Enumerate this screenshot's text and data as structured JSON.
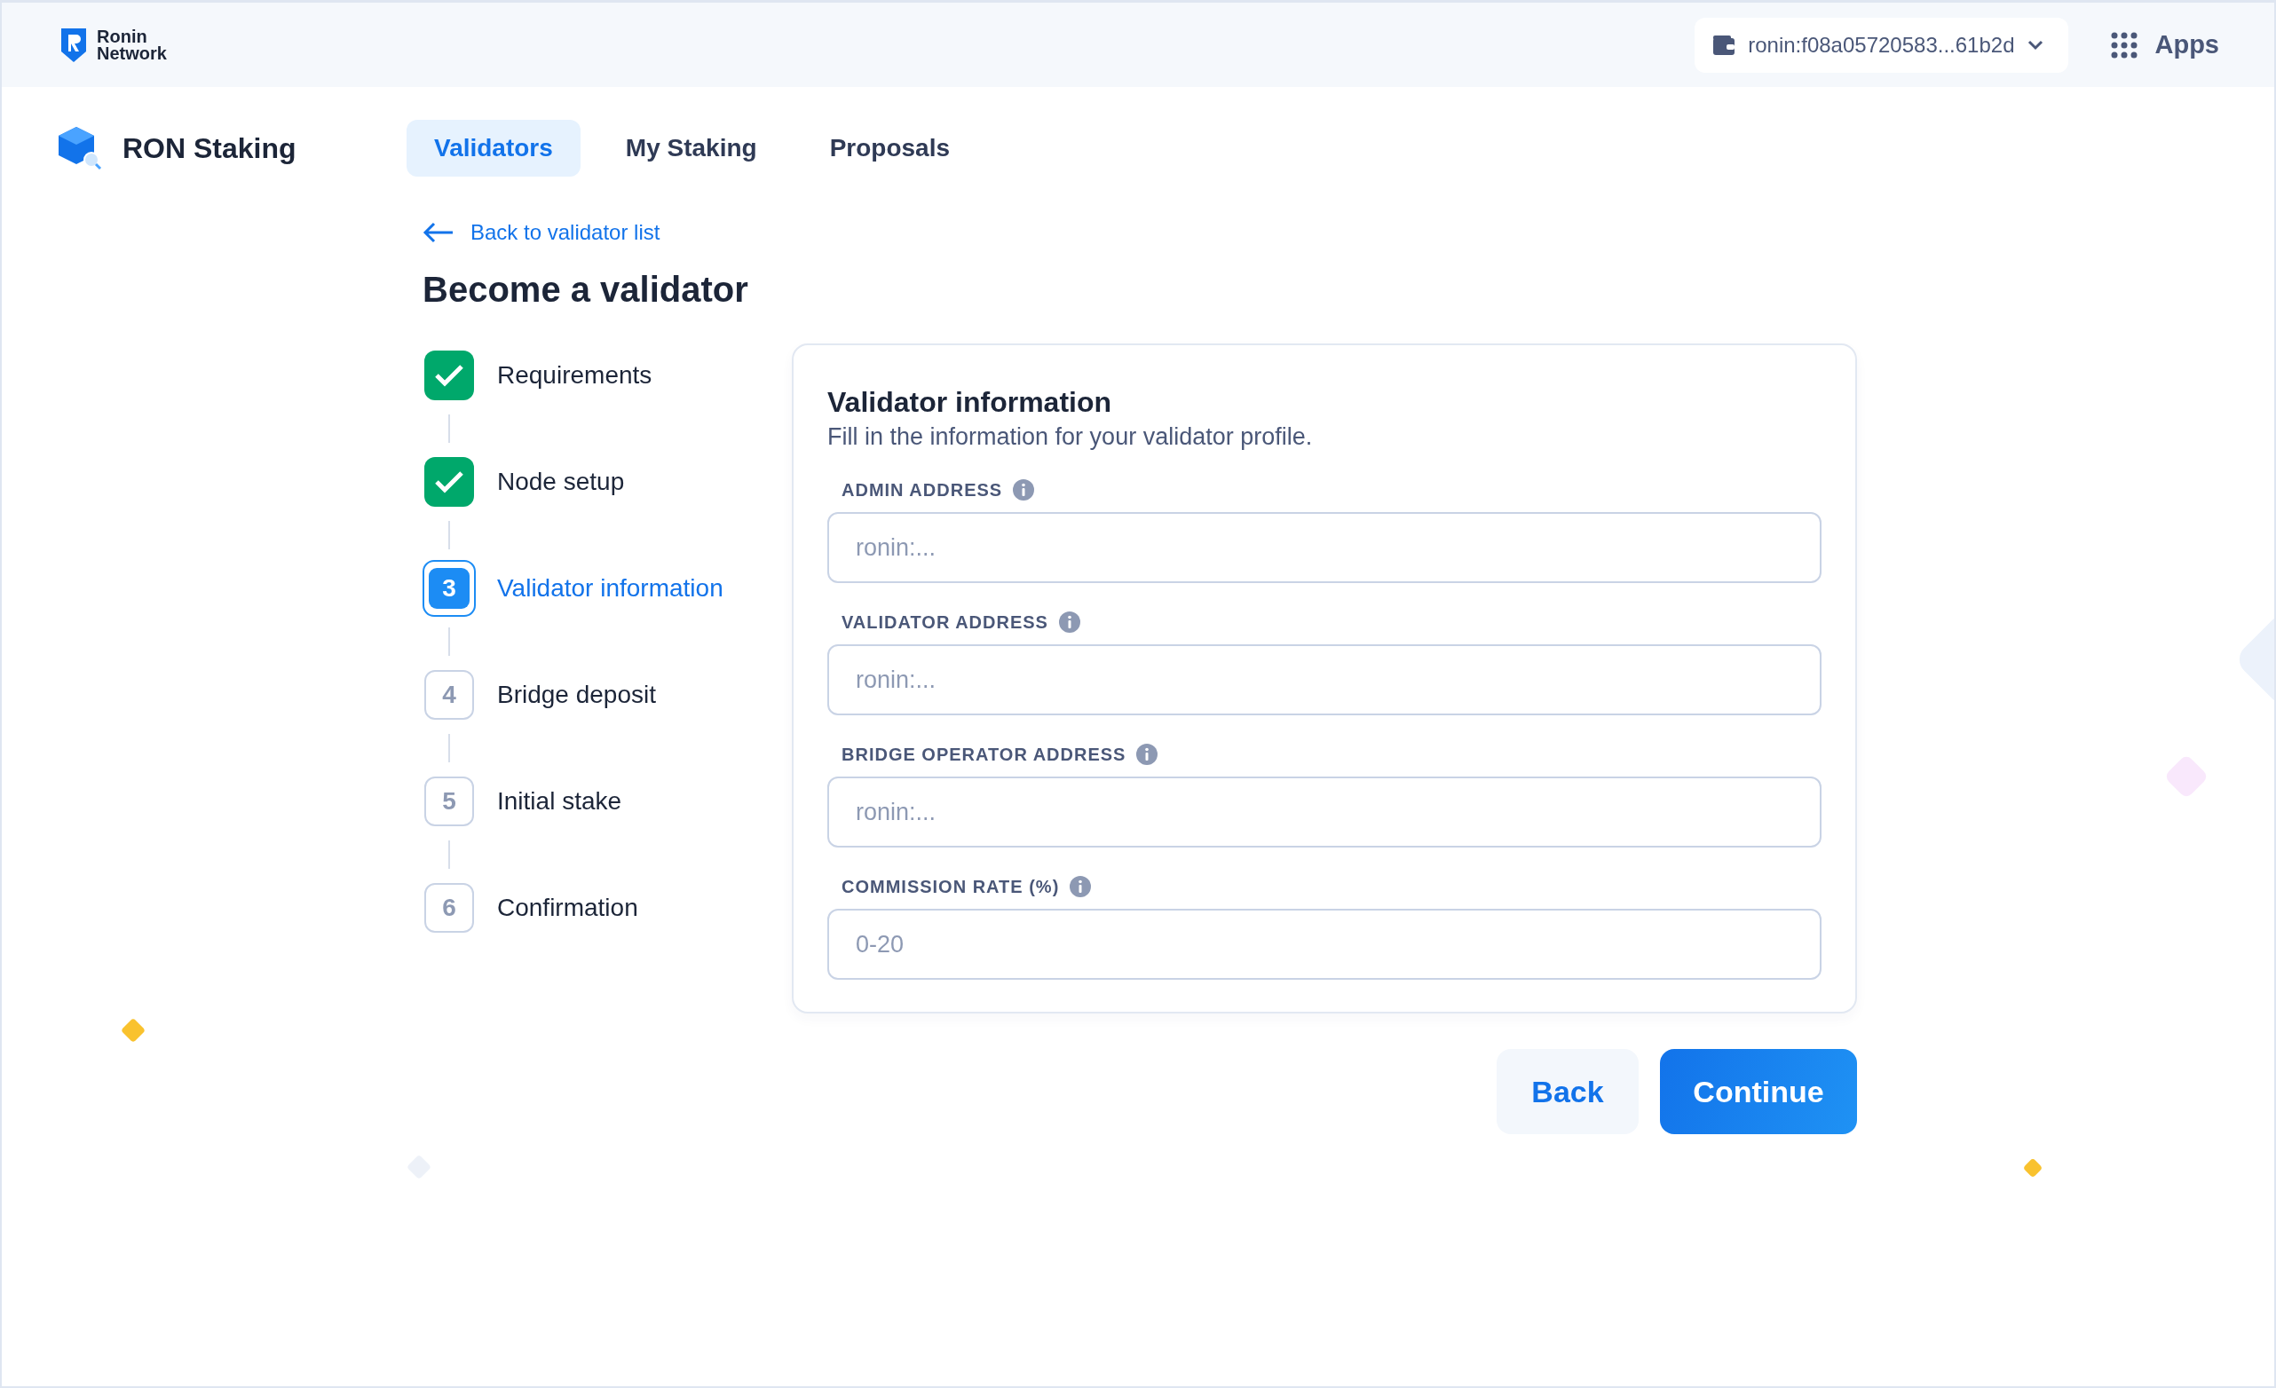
{
  "header": {
    "brand": [
      "Ronin",
      "Network"
    ],
    "wallet": "ronin:f08a05720583...61b2d",
    "apps": "Apps"
  },
  "app": {
    "name": "RON Staking"
  },
  "tabs": [
    {
      "label": "Validators",
      "selected": true
    },
    {
      "label": "My Staking",
      "selected": false
    },
    {
      "label": "Proposals",
      "selected": false
    }
  ],
  "back_link": "Back to validator list",
  "title": "Become a validator",
  "steps": [
    {
      "kind": "done",
      "label": "Requirements"
    },
    {
      "kind": "done",
      "label": "Node setup"
    },
    {
      "kind": "current",
      "number": "3",
      "label": "Validator information"
    },
    {
      "kind": "pending",
      "number": "4",
      "label": "Bridge deposit"
    },
    {
      "kind": "pending",
      "number": "5",
      "label": "Initial stake"
    },
    {
      "kind": "pending",
      "number": "6",
      "label": "Confirmation"
    }
  ],
  "form": {
    "title": "Validator information",
    "subtitle": "Fill in the information for your validator profile.",
    "fields": [
      {
        "label": "ADMIN ADDRESS",
        "placeholder": "ronin:..."
      },
      {
        "label": "VALIDATOR ADDRESS",
        "placeholder": "ronin:..."
      },
      {
        "label": "BRIDGE OPERATOR ADDRESS",
        "placeholder": "ronin:..."
      },
      {
        "label": "COMMISSION RATE (%)",
        "placeholder": "0-20"
      }
    ]
  },
  "buttons": {
    "back": "Back",
    "continue": "Continue"
  }
}
